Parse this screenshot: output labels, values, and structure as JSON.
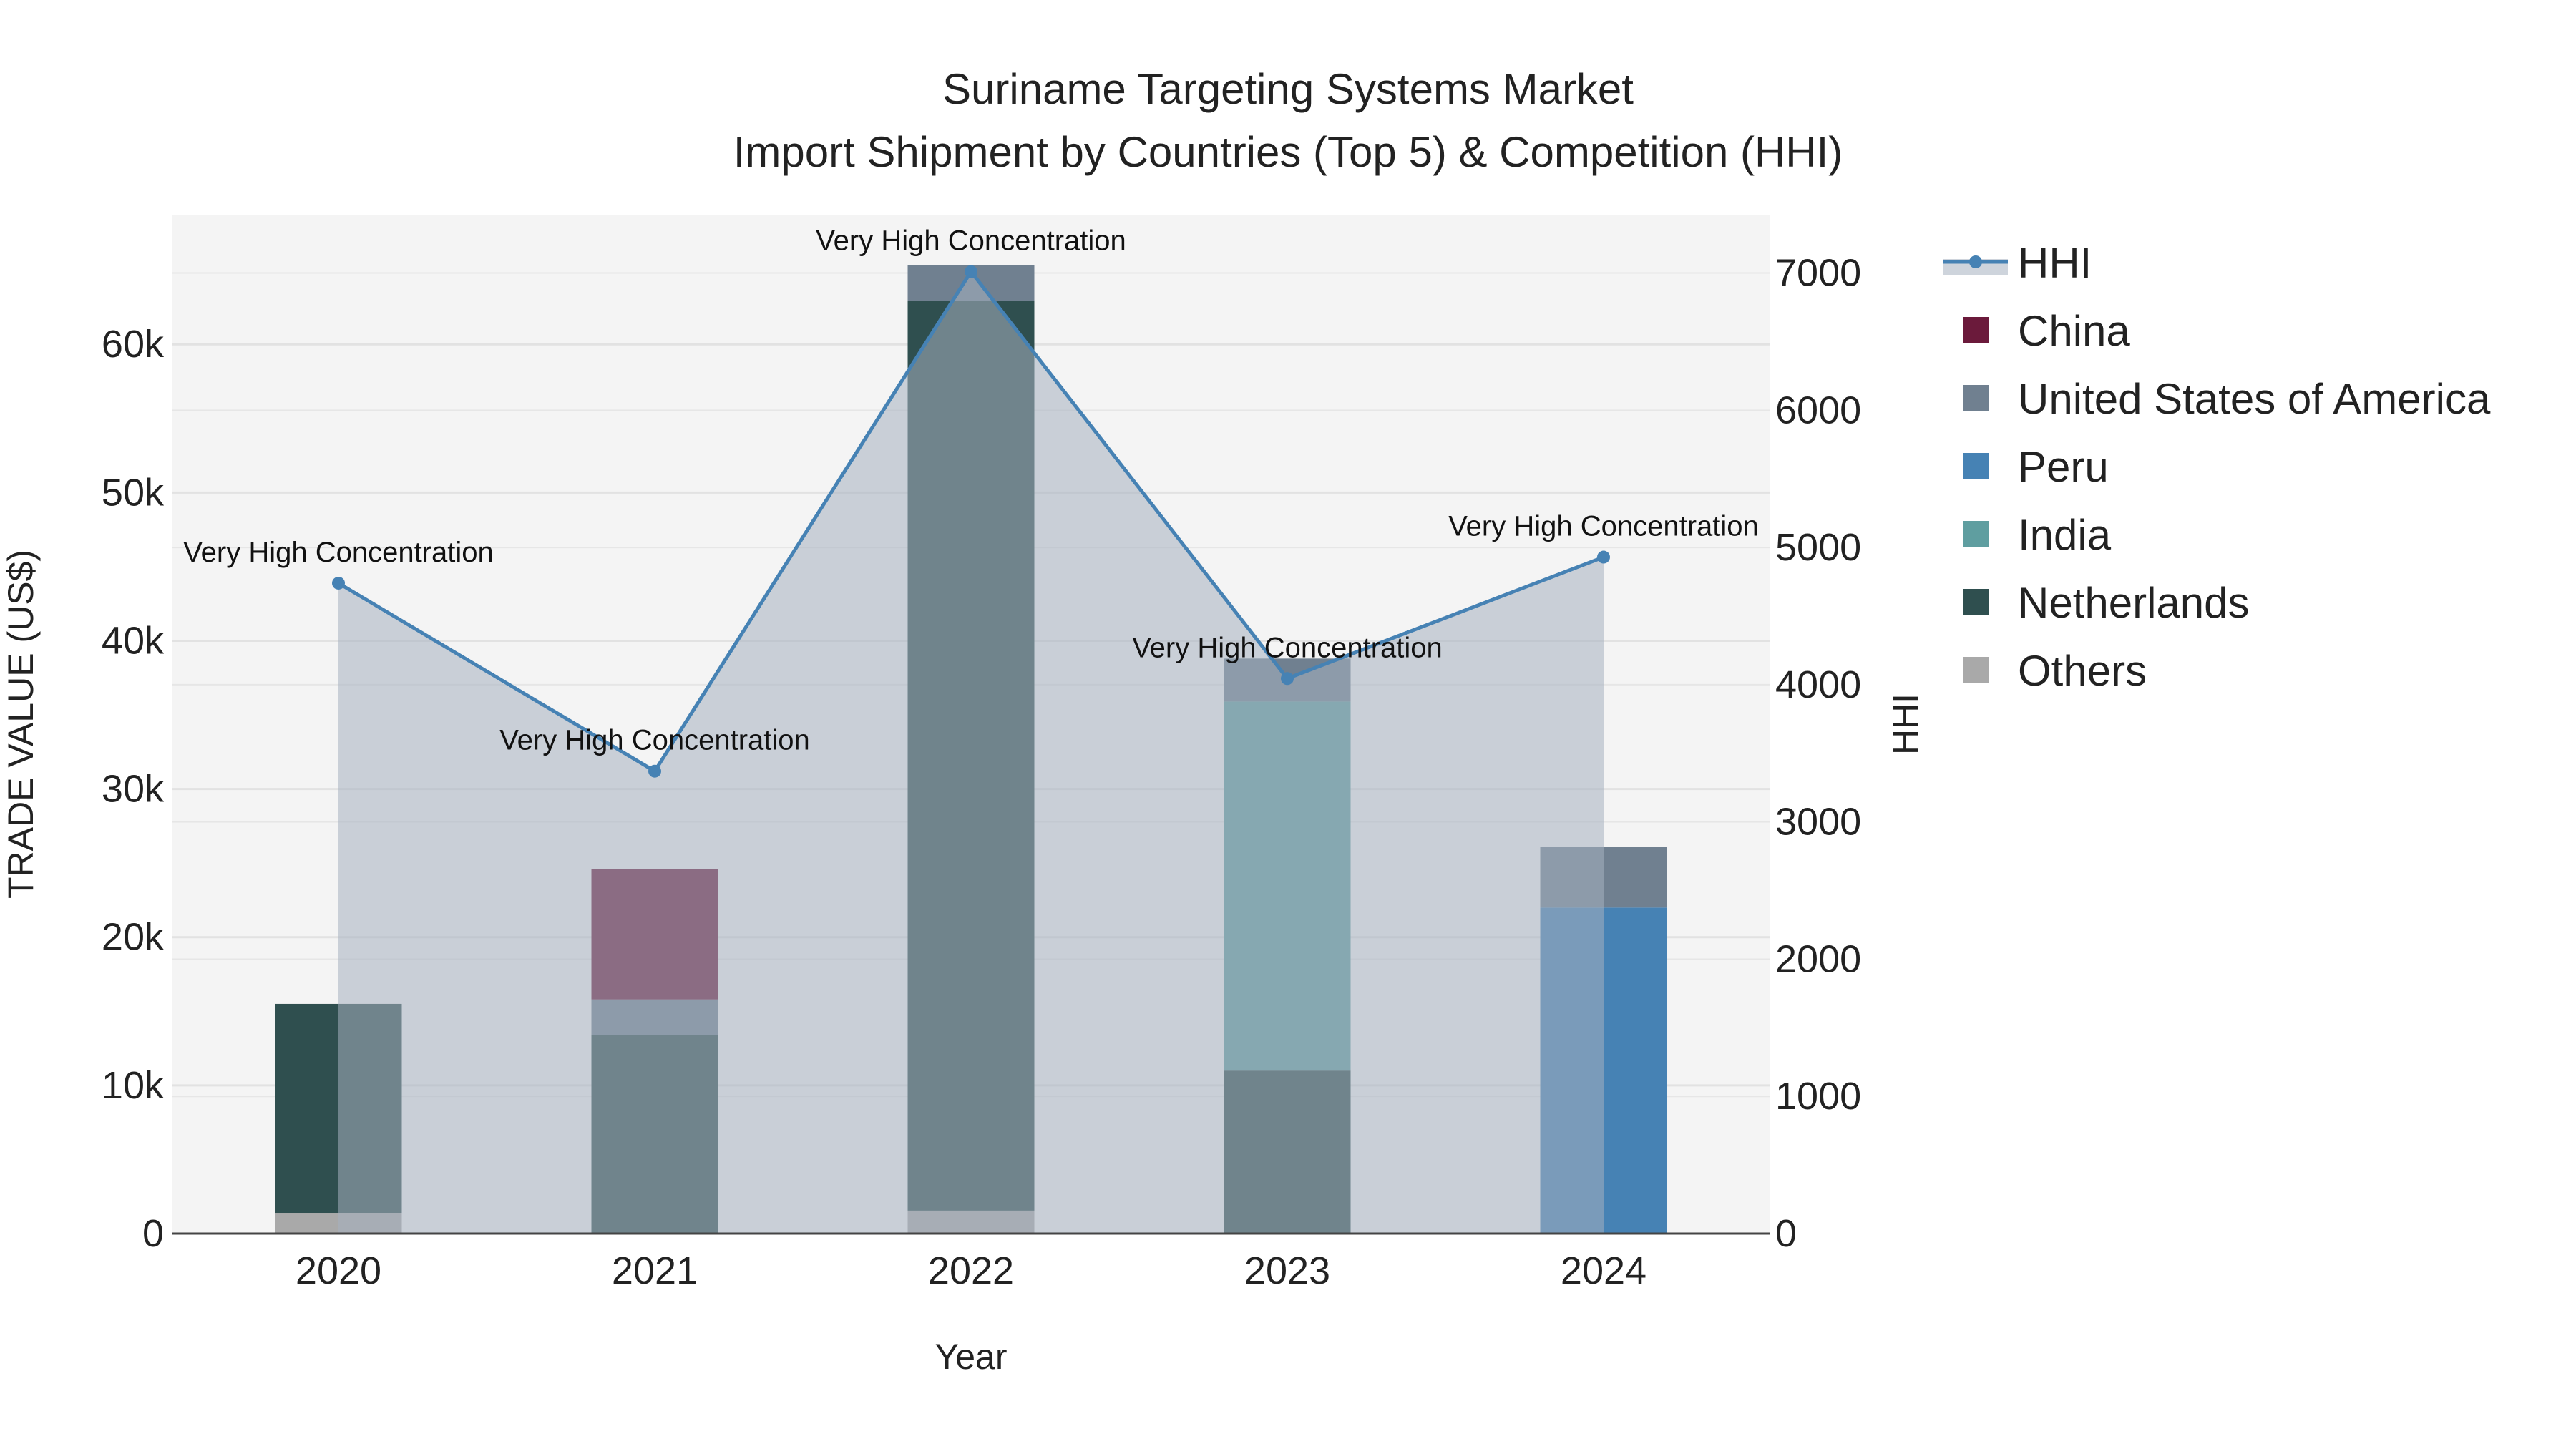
{
  "chart_data": {
    "type": "bar",
    "title": "Suriname Targeting Systems Market",
    "subtitle": "Import Shipment by Countries (Top 5) & Competition (HHI)",
    "xlabel": "Year",
    "ylabel": "TRADE VALUE (US$)",
    "y2label": "HHI",
    "categories": [
      "2020",
      "2021",
      "2022",
      "2023",
      "2024"
    ],
    "ylim": [
      0,
      68700
    ],
    "y_ticks": [
      0,
      10000,
      20000,
      30000,
      40000,
      50000,
      60000
    ],
    "y_tick_labels": [
      "0",
      "10k",
      "20k",
      "30k",
      "40k",
      "50k",
      "60k"
    ],
    "y2lim": [
      0,
      7420
    ],
    "y2_ticks": [
      0,
      1000,
      2000,
      3000,
      4000,
      5000,
      6000,
      7000
    ],
    "y2_tick_labels": [
      "0",
      "1000",
      "2000",
      "3000",
      "4000",
      "5000",
      "6000",
      "7000"
    ],
    "barmode": "stack",
    "series": [
      {
        "name": "Others",
        "color": "#a9a9a9",
        "values": [
          1400,
          0,
          1550,
          0,
          0
        ]
      },
      {
        "name": "Netherlands",
        "color": "#2f4f4f",
        "values": [
          14100,
          13400,
          61400,
          11000,
          0
        ]
      },
      {
        "name": "India",
        "color": "#5f9ea0",
        "values": [
          0,
          0,
          0,
          24900,
          0
        ]
      },
      {
        "name": "Peru",
        "color": "#4682b4",
        "values": [
          0,
          0,
          0,
          0,
          22000
        ]
      },
      {
        "name": "United States of America",
        "color": "#708090",
        "values": [
          0,
          2400,
          2400,
          2900,
          4100
        ]
      },
      {
        "name": "China",
        "color": "#6b1a3b",
        "values": [
          0,
          8800,
          0,
          0,
          0
        ]
      }
    ],
    "hhi": {
      "name": "HHI",
      "color": "#4682b4",
      "values": [
        4740,
        3370,
        7010,
        4045,
        4930
      ],
      "annotations": [
        "Very High Concentration",
        "Very High Concentration",
        "Very High Concentration",
        "Very High Concentration",
        "Very High Concentration"
      ]
    },
    "legend": {
      "placement": "right",
      "items": [
        "HHI",
        "China",
        "United States of America",
        "Peru",
        "India",
        "Netherlands",
        "Others"
      ]
    },
    "grid": true
  }
}
